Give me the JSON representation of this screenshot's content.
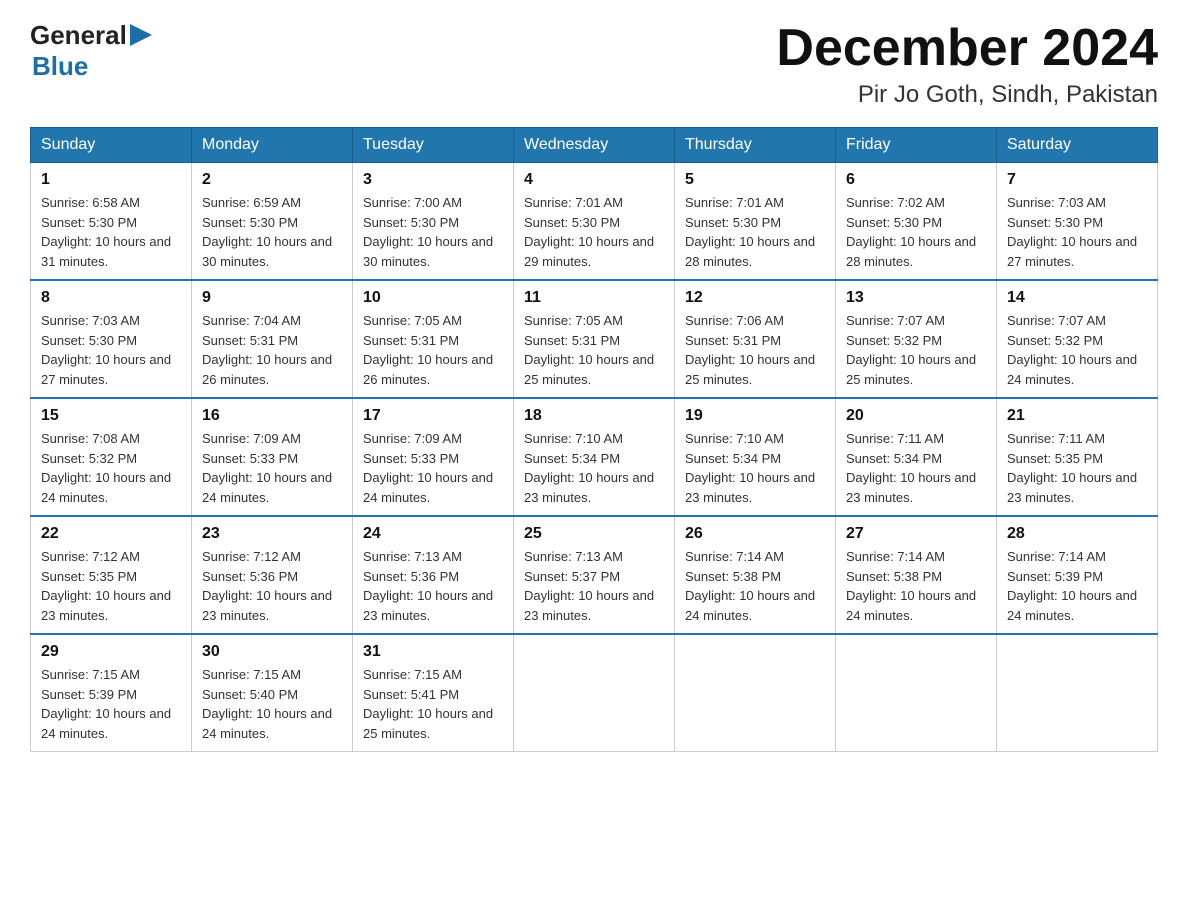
{
  "logo": {
    "general": "General",
    "arrow": "▶",
    "blue": "Blue"
  },
  "title": {
    "month_year": "December 2024",
    "location": "Pir Jo Goth, Sindh, Pakistan"
  },
  "weekdays": [
    "Sunday",
    "Monday",
    "Tuesday",
    "Wednesday",
    "Thursday",
    "Friday",
    "Saturday"
  ],
  "weeks": [
    [
      {
        "day": "1",
        "sunrise": "6:58 AM",
        "sunset": "5:30 PM",
        "daylight": "10 hours and 31 minutes."
      },
      {
        "day": "2",
        "sunrise": "6:59 AM",
        "sunset": "5:30 PM",
        "daylight": "10 hours and 30 minutes."
      },
      {
        "day": "3",
        "sunrise": "7:00 AM",
        "sunset": "5:30 PM",
        "daylight": "10 hours and 30 minutes."
      },
      {
        "day": "4",
        "sunrise": "7:01 AM",
        "sunset": "5:30 PM",
        "daylight": "10 hours and 29 minutes."
      },
      {
        "day": "5",
        "sunrise": "7:01 AM",
        "sunset": "5:30 PM",
        "daylight": "10 hours and 28 minutes."
      },
      {
        "day": "6",
        "sunrise": "7:02 AM",
        "sunset": "5:30 PM",
        "daylight": "10 hours and 28 minutes."
      },
      {
        "day": "7",
        "sunrise": "7:03 AM",
        "sunset": "5:30 PM",
        "daylight": "10 hours and 27 minutes."
      }
    ],
    [
      {
        "day": "8",
        "sunrise": "7:03 AM",
        "sunset": "5:30 PM",
        "daylight": "10 hours and 27 minutes."
      },
      {
        "day": "9",
        "sunrise": "7:04 AM",
        "sunset": "5:31 PM",
        "daylight": "10 hours and 26 minutes."
      },
      {
        "day": "10",
        "sunrise": "7:05 AM",
        "sunset": "5:31 PM",
        "daylight": "10 hours and 26 minutes."
      },
      {
        "day": "11",
        "sunrise": "7:05 AM",
        "sunset": "5:31 PM",
        "daylight": "10 hours and 25 minutes."
      },
      {
        "day": "12",
        "sunrise": "7:06 AM",
        "sunset": "5:31 PM",
        "daylight": "10 hours and 25 minutes."
      },
      {
        "day": "13",
        "sunrise": "7:07 AM",
        "sunset": "5:32 PM",
        "daylight": "10 hours and 25 minutes."
      },
      {
        "day": "14",
        "sunrise": "7:07 AM",
        "sunset": "5:32 PM",
        "daylight": "10 hours and 24 minutes."
      }
    ],
    [
      {
        "day": "15",
        "sunrise": "7:08 AM",
        "sunset": "5:32 PM",
        "daylight": "10 hours and 24 minutes."
      },
      {
        "day": "16",
        "sunrise": "7:09 AM",
        "sunset": "5:33 PM",
        "daylight": "10 hours and 24 minutes."
      },
      {
        "day": "17",
        "sunrise": "7:09 AM",
        "sunset": "5:33 PM",
        "daylight": "10 hours and 24 minutes."
      },
      {
        "day": "18",
        "sunrise": "7:10 AM",
        "sunset": "5:34 PM",
        "daylight": "10 hours and 23 minutes."
      },
      {
        "day": "19",
        "sunrise": "7:10 AM",
        "sunset": "5:34 PM",
        "daylight": "10 hours and 23 minutes."
      },
      {
        "day": "20",
        "sunrise": "7:11 AM",
        "sunset": "5:34 PM",
        "daylight": "10 hours and 23 minutes."
      },
      {
        "day": "21",
        "sunrise": "7:11 AM",
        "sunset": "5:35 PM",
        "daylight": "10 hours and 23 minutes."
      }
    ],
    [
      {
        "day": "22",
        "sunrise": "7:12 AM",
        "sunset": "5:35 PM",
        "daylight": "10 hours and 23 minutes."
      },
      {
        "day": "23",
        "sunrise": "7:12 AM",
        "sunset": "5:36 PM",
        "daylight": "10 hours and 23 minutes."
      },
      {
        "day": "24",
        "sunrise": "7:13 AM",
        "sunset": "5:36 PM",
        "daylight": "10 hours and 23 minutes."
      },
      {
        "day": "25",
        "sunrise": "7:13 AM",
        "sunset": "5:37 PM",
        "daylight": "10 hours and 23 minutes."
      },
      {
        "day": "26",
        "sunrise": "7:14 AM",
        "sunset": "5:38 PM",
        "daylight": "10 hours and 24 minutes."
      },
      {
        "day": "27",
        "sunrise": "7:14 AM",
        "sunset": "5:38 PM",
        "daylight": "10 hours and 24 minutes."
      },
      {
        "day": "28",
        "sunrise": "7:14 AM",
        "sunset": "5:39 PM",
        "daylight": "10 hours and 24 minutes."
      }
    ],
    [
      {
        "day": "29",
        "sunrise": "7:15 AM",
        "sunset": "5:39 PM",
        "daylight": "10 hours and 24 minutes."
      },
      {
        "day": "30",
        "sunrise": "7:15 AM",
        "sunset": "5:40 PM",
        "daylight": "10 hours and 24 minutes."
      },
      {
        "day": "31",
        "sunrise": "7:15 AM",
        "sunset": "5:41 PM",
        "daylight": "10 hours and 25 minutes."
      },
      null,
      null,
      null,
      null
    ]
  ]
}
